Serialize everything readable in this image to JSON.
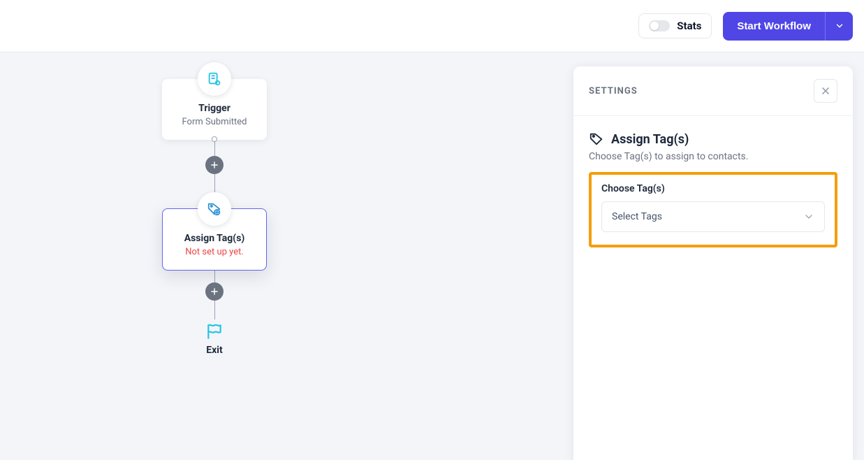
{
  "header": {
    "stats_label": "Stats",
    "start_label": "Start Workflow"
  },
  "flow": {
    "trigger": {
      "title": "Trigger",
      "subtitle": "Form Submitted"
    },
    "action": {
      "title": "Assign Tag(s)",
      "subtitle": "Not set up yet."
    },
    "exit_label": "Exit"
  },
  "panel": {
    "header_title": "SETTINGS",
    "title": "Assign Tag(s)",
    "description": "Choose Tag(s) to assign to contacts.",
    "field_label": "Choose Tag(s)",
    "select_placeholder": "Select Tags"
  },
  "colors": {
    "primary": "#4f46e5",
    "accent_cyan": "#22c3e6",
    "highlight": "#f59e0b",
    "error": "#ef4444"
  }
}
